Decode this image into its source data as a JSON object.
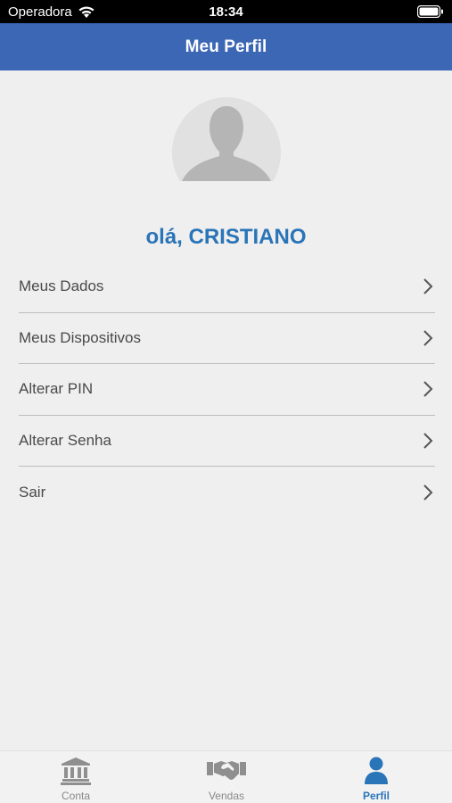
{
  "status_bar": {
    "carrier": "Operadora",
    "time": "18:34",
    "icons": [
      "wifi-icon",
      "battery-icon"
    ]
  },
  "nav": {
    "title": "Meu Perfil"
  },
  "profile": {
    "avatar_icon": "user-silhouette-icon",
    "greeting": "olá, CRISTIANO"
  },
  "menu": {
    "items": [
      {
        "label": "Meus Dados"
      },
      {
        "label": "Meus Dispositivos"
      },
      {
        "label": "Alterar PIN"
      },
      {
        "label": "Alterar Senha"
      },
      {
        "label": "Sair"
      }
    ]
  },
  "tab_bar": {
    "tabs": [
      {
        "label": "Conta",
        "icon": "bank-icon",
        "active": false
      },
      {
        "label": "Vendas",
        "icon": "handshake-icon",
        "active": false
      },
      {
        "label": "Perfil",
        "icon": "person-icon",
        "active": true
      }
    ]
  },
  "colors": {
    "nav_background": "#3c67b5",
    "accent": "#2a74b8",
    "inactive_tab": "#888888",
    "background": "#efefef"
  }
}
